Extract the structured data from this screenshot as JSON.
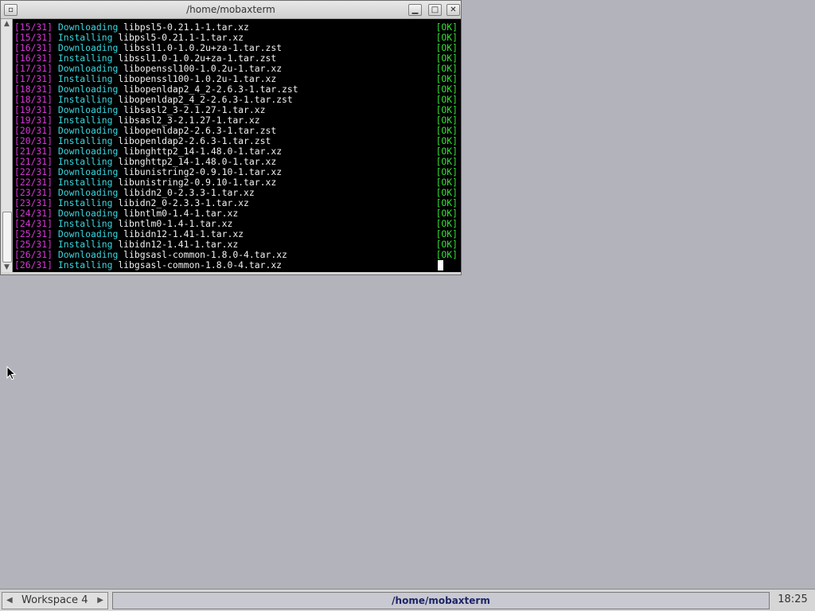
{
  "window": {
    "title": "/home/mobaxterm",
    "menu_glyph": "▫",
    "min_glyph": "▁",
    "max_glyph": "□",
    "close_glyph": "✕"
  },
  "terminal": {
    "lines": [
      {
        "num": "[15/31]",
        "action": "Downloading",
        "file": "libpsl5-0.21.1-1.tar.xz",
        "status": "[OK]"
      },
      {
        "num": "[15/31]",
        "action": "Installing",
        "file": "libpsl5-0.21.1-1.tar.xz",
        "status": "[OK]"
      },
      {
        "num": "[16/31]",
        "action": "Downloading",
        "file": "libssl1.0-1.0.2u+za-1.tar.zst",
        "status": "[OK]"
      },
      {
        "num": "[16/31]",
        "action": "Installing",
        "file": "libssl1.0-1.0.2u+za-1.tar.zst",
        "status": "[OK]"
      },
      {
        "num": "[17/31]",
        "action": "Downloading",
        "file": "libopenssl100-1.0.2u-1.tar.xz",
        "status": "[OK]"
      },
      {
        "num": "[17/31]",
        "action": "Installing",
        "file": "libopenssl100-1.0.2u-1.tar.xz",
        "status": "[OK]"
      },
      {
        "num": "[18/31]",
        "action": "Downloading",
        "file": "libopenldap2_4_2-2.6.3-1.tar.zst",
        "status": "[OK]"
      },
      {
        "num": "[18/31]",
        "action": "Installing",
        "file": "libopenldap2_4_2-2.6.3-1.tar.zst",
        "status": "[OK]"
      },
      {
        "num": "[19/31]",
        "action": "Downloading",
        "file": "libsasl2_3-2.1.27-1.tar.xz",
        "status": "[OK]"
      },
      {
        "num": "[19/31]",
        "action": "Installing",
        "file": "libsasl2_3-2.1.27-1.tar.xz",
        "status": "[OK]"
      },
      {
        "num": "[20/31]",
        "action": "Downloading",
        "file": "libopenldap2-2.6.3-1.tar.zst",
        "status": "[OK]"
      },
      {
        "num": "[20/31]",
        "action": "Installing",
        "file": "libopenldap2-2.6.3-1.tar.zst",
        "status": "[OK]"
      },
      {
        "num": "[21/31]",
        "action": "Downloading",
        "file": "libnghttp2_14-1.48.0-1.tar.xz",
        "status": "[OK]"
      },
      {
        "num": "[21/31]",
        "action": "Installing",
        "file": "libnghttp2_14-1.48.0-1.tar.xz",
        "status": "[OK]"
      },
      {
        "num": "[22/31]",
        "action": "Downloading",
        "file": "libunistring2-0.9.10-1.tar.xz",
        "status": "[OK]"
      },
      {
        "num": "[22/31]",
        "action": "Installing",
        "file": "libunistring2-0.9.10-1.tar.xz",
        "status": "[OK]"
      },
      {
        "num": "[23/31]",
        "action": "Downloading",
        "file": "libidn2_0-2.3.3-1.tar.xz",
        "status": "[OK]"
      },
      {
        "num": "[23/31]",
        "action": "Installing",
        "file": "libidn2_0-2.3.3-1.tar.xz",
        "status": "[OK]"
      },
      {
        "num": "[24/31]",
        "action": "Downloading",
        "file": "libntlm0-1.4-1.tar.xz",
        "status": "[OK]"
      },
      {
        "num": "[24/31]",
        "action": "Installing",
        "file": "libntlm0-1.4-1.tar.xz",
        "status": "[OK]"
      },
      {
        "num": "[25/31]",
        "action": "Downloading",
        "file": "libidn12-1.41-1.tar.xz",
        "status": "[OK]"
      },
      {
        "num": "[25/31]",
        "action": "Installing",
        "file": "libidn12-1.41-1.tar.xz",
        "status": "[OK]"
      },
      {
        "num": "[26/31]",
        "action": "Downloading",
        "file": "libgsasl-common-1.8.0-4.tar.xz",
        "status": "[OK]"
      },
      {
        "num": "[26/31]",
        "action": "Installing",
        "file": "libgsasl-common-1.8.0-4.tar.xz",
        "status": ""
      }
    ]
  },
  "taskbar": {
    "workspace_label": "Workspace 4",
    "prev_glyph": "◀",
    "next_glyph": "▶",
    "task_title": "/home/mobaxterm",
    "clock": "18:25"
  },
  "colors": {
    "desktop": "#b3b3bc",
    "terminal_bg": "#000000",
    "step_number": "#d838d8",
    "action": "#38d8e0",
    "ok": "#30e030"
  }
}
